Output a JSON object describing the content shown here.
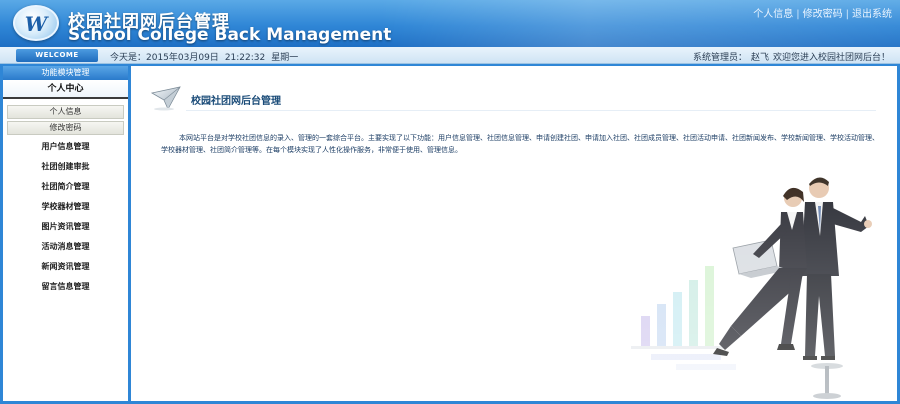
{
  "header": {
    "logo_letter": "W",
    "title_cn": "校园社团网后台管理",
    "title_en": "School College Back Management",
    "links": [
      "个人信息",
      "修改密码",
      "退出系统"
    ]
  },
  "infobar": {
    "welcome": "WELCOME",
    "today_label": "今天是：2015年03月09日",
    "time": "21:22:32",
    "weekday": "星期一",
    "admin_label": "系统管理员：",
    "admin_name": "赵飞",
    "welcome_message": "欢迎您进入校园社团网后台！"
  },
  "sidebar": {
    "header": "功能模块管理",
    "personal_center": "个人中心",
    "personal_children": [
      "个人信息",
      "修改密码"
    ],
    "items": [
      "用户信息管理",
      "社团创建审批",
      "社团简介管理",
      "学校器材管理",
      "图片资讯管理",
      "活动消息管理",
      "新闻资讯管理",
      "留言信息管理"
    ]
  },
  "main": {
    "title": "校园社团网后台管理",
    "intro": "本网站平台是对学校社团信息的录入、管理的一套综合平台。主要实现了以下功能：用户信息管理、社团信息管理、申请创建社团、申请加入社团、社团成员管理、社团活动申请、社团新闻发布、学校新闻管理、学校活动管理、学校器材管理、社团简介管理等。在每个模块实现了人性化操作服务，非常便于使用、管理信息。"
  },
  "colors": {
    "header_blue": "#2f86d6",
    "nav_text": "#222222",
    "intro_text": "#1e3f66"
  }
}
